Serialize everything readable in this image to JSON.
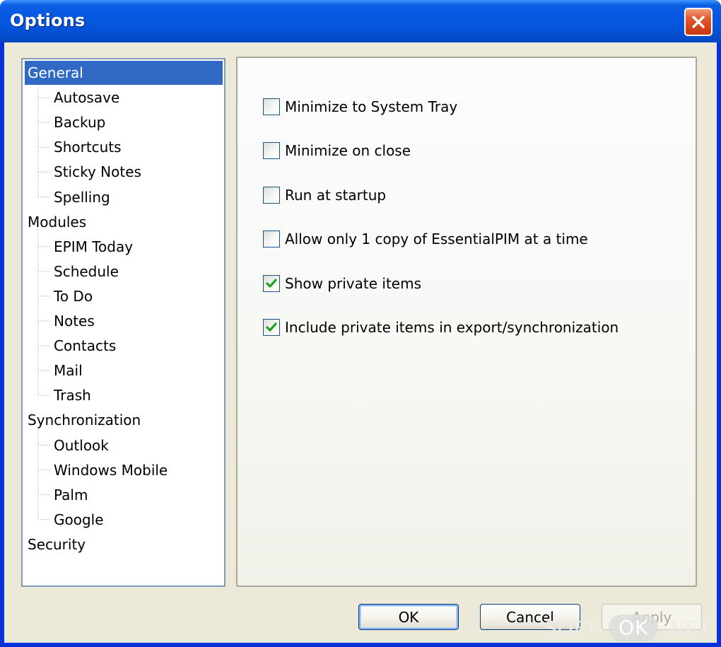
{
  "window": {
    "title": "Options",
    "close_icon": "close-x-icon"
  },
  "tree": {
    "items": [
      {
        "label": "General",
        "level": 0,
        "selected": true
      },
      {
        "label": "Autosave",
        "level": 1
      },
      {
        "label": "Backup",
        "level": 1
      },
      {
        "label": "Shortcuts",
        "level": 1
      },
      {
        "label": "Sticky Notes",
        "level": 1
      },
      {
        "label": "Spelling",
        "level": 1
      },
      {
        "label": "Modules",
        "level": 0
      },
      {
        "label": "EPIM Today",
        "level": 1
      },
      {
        "label": "Schedule",
        "level": 1
      },
      {
        "label": "To Do",
        "level": 1
      },
      {
        "label": "Notes",
        "level": 1
      },
      {
        "label": "Contacts",
        "level": 1
      },
      {
        "label": "Mail",
        "level": 1
      },
      {
        "label": "Trash",
        "level": 1
      },
      {
        "label": "Synchronization",
        "level": 0
      },
      {
        "label": "Outlook",
        "level": 1
      },
      {
        "label": "Windows Mobile",
        "level": 1
      },
      {
        "label": "Palm",
        "level": 1
      },
      {
        "label": "Google",
        "level": 1
      },
      {
        "label": "Security",
        "level": 0
      }
    ]
  },
  "options": [
    {
      "label": "Minimize to System Tray",
      "checked": false
    },
    {
      "label": "Minimize on close",
      "checked": false
    },
    {
      "label": "Run at startup",
      "checked": false
    },
    {
      "label": "Allow only 1 copy of EssentialPIM at a time",
      "checked": false
    },
    {
      "label": "Show private items",
      "checked": true
    },
    {
      "label": "Include private items in export/synchronization",
      "checked": true
    }
  ],
  "buttons": {
    "ok": "OK",
    "cancel": "Cancel",
    "apply": "Apply"
  },
  "watermark": {
    "left": "SOFT-",
    "pill": "OK",
    "right": ".NET"
  },
  "colors": {
    "selection": "#316ac5",
    "check_mark": "#21a121",
    "titlebar": "#0553d8"
  }
}
